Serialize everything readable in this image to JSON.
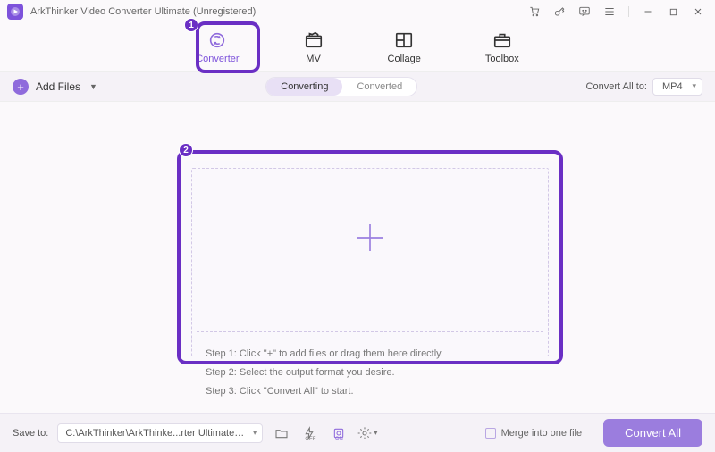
{
  "title": "ArkThinker Video Converter Ultimate (Unregistered)",
  "tabs": {
    "converter": "Converter",
    "mv": "MV",
    "collage": "Collage",
    "toolbox": "Toolbox"
  },
  "toolbar": {
    "add_files": "Add Files",
    "converting": "Converting",
    "converted": "Converted",
    "convert_all_to": "Convert All to:",
    "format": "MP4"
  },
  "dropzone": {
    "step1": "Step 1: Click \"+\" to add files or drag them here directly.",
    "step2": "Step 2: Select the output format you desire.",
    "step3": "Step 3: Click \"Convert All\" to start."
  },
  "bottom": {
    "save_to": "Save to:",
    "path": "C:\\ArkThinker\\ArkThinke...rter Ultimate\\Converted",
    "merge": "Merge into one file",
    "convert_all": "Convert All"
  },
  "annotations": {
    "num1": "1",
    "num2": "2"
  }
}
